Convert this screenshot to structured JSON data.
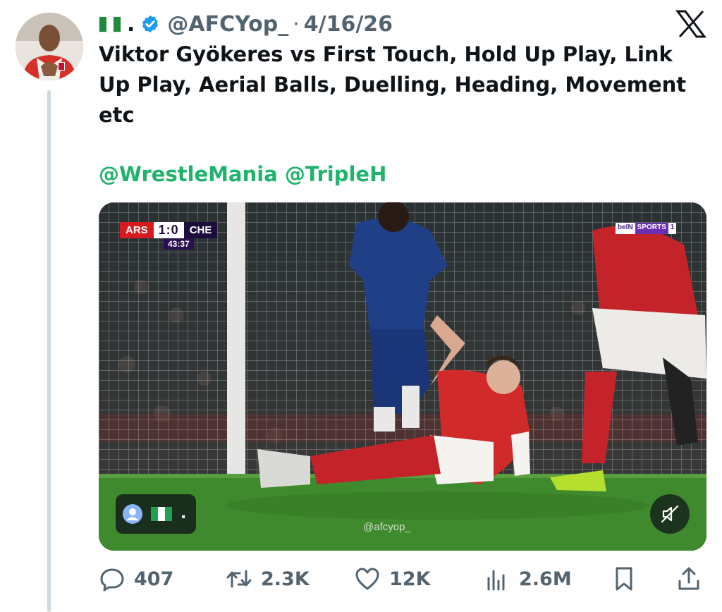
{
  "author": {
    "display_name_suffix": ".",
    "handle": "@AFCYop_",
    "separator": "·",
    "date": "4/16/26",
    "verified": true,
    "flag": "nigeria-flag",
    "avatar": "avatar"
  },
  "platform_icon": "x-logo-icon",
  "post": {
    "text_lines": [
      "Viktor Gyökeres vs First Touch, Hold Up Play, Link",
      "Up Play, Aerial Balls, Duelling, Heading, Movement",
      "etc"
    ],
    "mentions": [
      "@WrestleMania",
      "@TripleH"
    ]
  },
  "media": {
    "type": "video",
    "scorebug": {
      "home": "ARS",
      "score": "1:0",
      "away": "CHE",
      "clock": "43:37"
    },
    "channel": {
      "part1": "beIN",
      "part2": "SPORTS",
      "part3": "1"
    },
    "watermark": "@afcyop_",
    "attribution": {
      "icon": "user-icon",
      "flag": "nigeria-flag",
      "dot": "."
    },
    "mute_icon": "muted-speaker-icon"
  },
  "actions": {
    "replies": {
      "icon": "reply-icon",
      "count": "407"
    },
    "reposts": {
      "icon": "repost-icon",
      "count": "2.3K"
    },
    "likes": {
      "icon": "heart-icon",
      "count": "12K"
    },
    "views": {
      "icon": "views-icon",
      "count": "2.6M"
    },
    "bookmark": {
      "icon": "bookmark-icon"
    },
    "share": {
      "icon": "share-icon"
    }
  },
  "colors": {
    "text": "#0f1419",
    "muted": "#536471",
    "mention": "#1fb36b",
    "verified": "#1d9bf0",
    "thread_line": "#cfd9de"
  }
}
